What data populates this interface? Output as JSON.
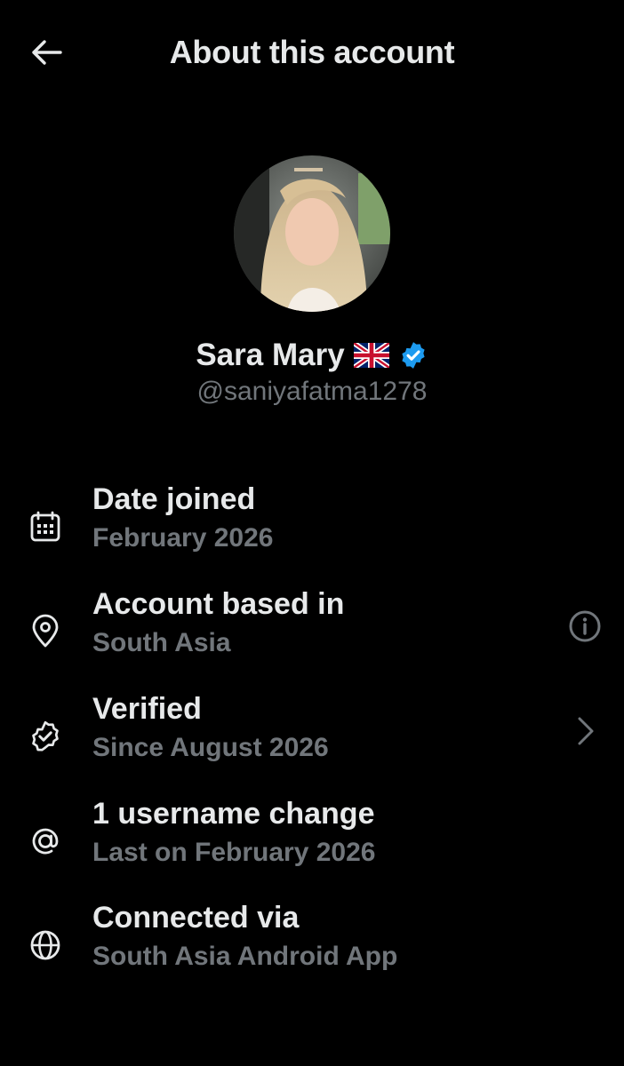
{
  "header": {
    "title": "About this account"
  },
  "profile": {
    "name": "Sara Mary",
    "flag": "🇬🇧",
    "handle": "@saniyafatma1278",
    "verified_color": "#1d9bf0"
  },
  "rows": [
    {
      "icon": "calendar-icon",
      "title": "Date joined",
      "subtitle": "February 2026"
    },
    {
      "icon": "location-pin-icon",
      "title": "Account based in",
      "subtitle": "South Asia",
      "trailing": "info-icon"
    },
    {
      "icon": "verified-badge-icon",
      "title": "Verified",
      "subtitle": "Since August 2026",
      "trailing": "chevron-right-icon"
    },
    {
      "icon": "at-sign-icon",
      "title": "1 username change",
      "subtitle": "Last on February 2026"
    },
    {
      "icon": "globe-icon",
      "title": "Connected via",
      "subtitle": "South Asia Android App"
    }
  ],
  "colors": {
    "background": "#000000",
    "primary_text": "#e7e9ea",
    "secondary_text": "#71767b",
    "accent": "#1d9bf0"
  }
}
